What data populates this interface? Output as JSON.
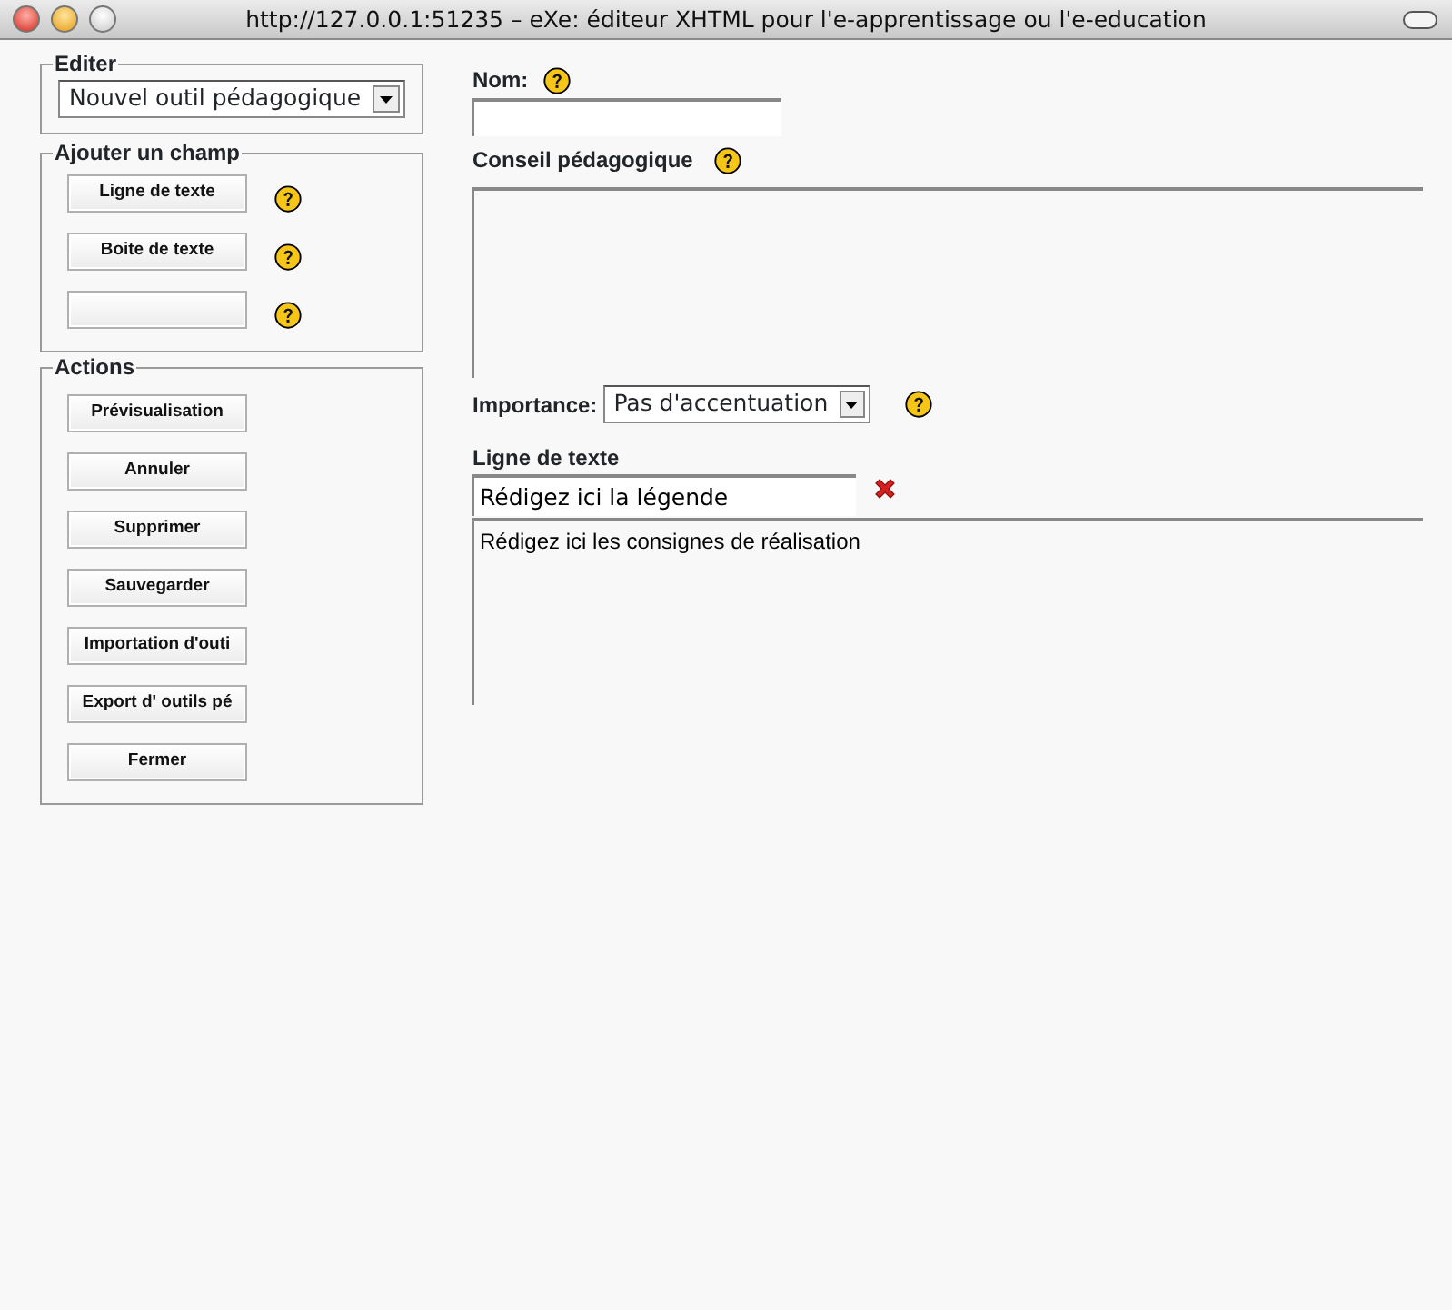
{
  "window": {
    "title": "http://127.0.0.1:51235 – eXe: éditeur XHTML pour l'e-apprentissage ou l'e-education"
  },
  "sidebar": {
    "edit": {
      "legend": "Editer",
      "dropdown": "Nouvel outil pédagogique"
    },
    "add_field": {
      "legend": "Ajouter un champ",
      "buttons": [
        {
          "kind": "labeled",
          "label": "Ligne de texte"
        },
        {
          "kind": "labeled",
          "label": "Boite de texte"
        },
        {
          "kind": "blank"
        }
      ]
    },
    "actions": {
      "legend": "Actions",
      "buttons": [
        "Prévisualisation",
        "Annuler",
        "Supprimer",
        "Sauvegarder",
        "Importation d'outi",
        "Export d' outils pé",
        "Fermer"
      ]
    }
  },
  "form": {
    "name_label": "Nom:",
    "advice_label": "Conseil pédagogique",
    "importance_label": "Importance:",
    "importance_value": "Pas d'accentuation",
    "field": {
      "title": "Ligne de texte",
      "caption": "Rédigez ici la légende",
      "instructions": "Rédigez ici les consignes de réalisation"
    }
  }
}
